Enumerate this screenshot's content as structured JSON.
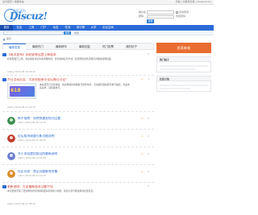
{
  "topbar": {
    "left_links": "设为首页 | 收藏本站",
    "right_text": "风格 | 切换到窄版 | Powered by"
  },
  "header": {
    "logo_text": "Discuz!",
    "logo_sub": "社区动力"
  },
  "login": {
    "username_label": "用户名",
    "password_label": "密码",
    "remember_label": "自动登录",
    "register_label": "找回密码",
    "login_button": "登录"
  },
  "nav": {
    "items": [
      "首页",
      "社区",
      "工具",
      "门户",
      "动态",
      "任务",
      "排行榜",
      "大学",
      "论坛空间"
    ]
  },
  "search": {
    "placeholder": "",
    "button": "搜索",
    "hot": "热搜"
  },
  "breadcrumb": {
    "text": "首页"
  },
  "tabs": [
    "最新发表",
    "最新热门",
    "最新精华",
    "最新回复",
    "热门投票",
    "我的帖子"
  ],
  "posts": [
    {
      "title": "【再次发布】网站安装设置上新版本",
      "meta": "admin  2024-06-18 09:20",
      "body": "标题首发已上线，欢迎前往论坛查看详细内容，支持多种显示方式，如需修改请告诉我们并跟进处理进度。",
      "count": "0",
      "style": "red"
    },
    {
      "title": "今日活动公告：大家积极参与论坛每日讨论！",
      "meta": "admin  2024-06-17 10:15",
      "body": "本站首页已全新改版，欢迎体验新的模板与组件布局。活动期间发帖即可参与抽奖，奖品丰富多样，请积极参与。",
      "thumb_word": "618",
      "count": "1",
      "like": "5",
      "style": "red"
    },
    {
      "title": "新手指南：如何快速发帖与回复",
      "meta": "admin  2024-06-16 14:32",
      "count": "0",
      "like": "2"
    },
    {
      "title": "论坛版块调整与新功能说明",
      "meta": "admin  2024-06-15 09:05",
      "count": "0",
      "like": "1"
    },
    {
      "title": "关于本站使用规范的最新说明",
      "meta": "admin  2024-06-14 16:48",
      "count": "0",
      "like": "3"
    },
    {
      "title": "社区问答：常见问题解答合集",
      "meta": "admin  2024-06-13 11:22",
      "count": "0",
      "like": "4"
    },
    {
      "title": "更新说明：大家最新版本功能介绍",
      "meta": "admin  2024-06-12 08:10",
      "body": "本次更新带来了更流畅的浏览体验和更多实用的小功能，欢迎大家升级使用并反馈意见。",
      "count": "0",
      "style": "red"
    }
  ],
  "sidebar": {
    "post_button": "发表新帖",
    "box1_title": "热门帖子",
    "box2_title": "社区公告"
  },
  "colors": {
    "nav_blue": "#2b6bd6",
    "accent_orange": "#e96d30",
    "title_red": "#d23b2f"
  }
}
